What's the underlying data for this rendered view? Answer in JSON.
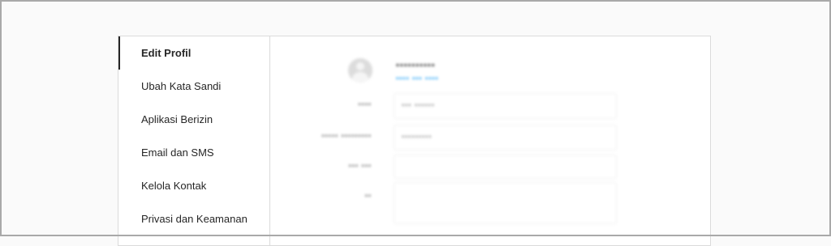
{
  "sidebar": {
    "items": [
      {
        "label": "Edit Profil"
      },
      {
        "label": "Ubah Kata Sandi"
      },
      {
        "label": "Aplikasi Berizin"
      },
      {
        "label": "Email dan SMS"
      },
      {
        "label": "Kelola Kontak"
      },
      {
        "label": "Privasi dan Keamanan"
      }
    ]
  },
  "profile": {
    "username": "••••••••••",
    "change_photo_label": "•••• ••• ••••",
    "fields": [
      {
        "label": "••••",
        "value": "••• ••••••"
      },
      {
        "label": "••••• •••••••••",
        "value": "•••••••••"
      },
      {
        "label": "••• •••",
        "value": ""
      },
      {
        "label": "••",
        "value": ""
      }
    ]
  }
}
